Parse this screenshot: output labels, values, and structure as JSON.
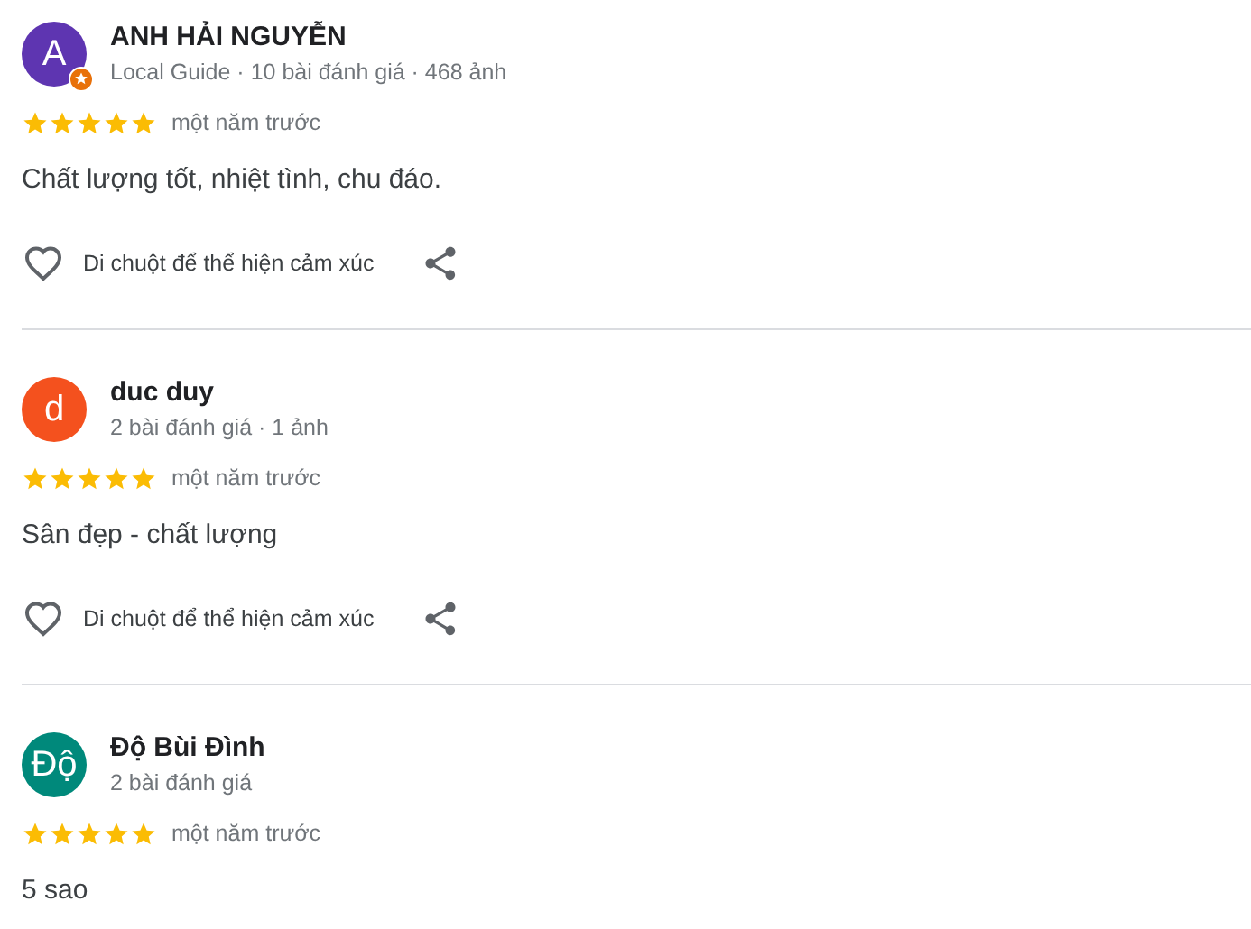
{
  "reviews": [
    {
      "avatar": "A",
      "color": "#5e35b1",
      "local_guide": true,
      "name": "ANH HẢI NGUYỄN",
      "meta": "Local Guide · 10 bài đánh giá · 468 ảnh",
      "stars": 5,
      "time": "một năm trước",
      "text": "Chất lượng tốt, nhiệt tình, chu đáo.",
      "reaction": "Di chuột để thể hiện cảm xúc"
    },
    {
      "avatar": "d",
      "color": "#f4511e",
      "local_guide": false,
      "name": "duc duy",
      "meta": "2 bài đánh giá · 1 ảnh",
      "stars": 5,
      "time": "một năm trước",
      "text": "Sân đẹp - chất lượng",
      "reaction": "Di chuột để thể hiện cảm xúc"
    },
    {
      "avatar": "Độ",
      "color": "#00897b",
      "local_guide": false,
      "name": "Độ Bùi Đình",
      "meta": "2 bài đánh giá",
      "stars": 5,
      "time": "một năm trước",
      "text": "5 sao"
    }
  ]
}
